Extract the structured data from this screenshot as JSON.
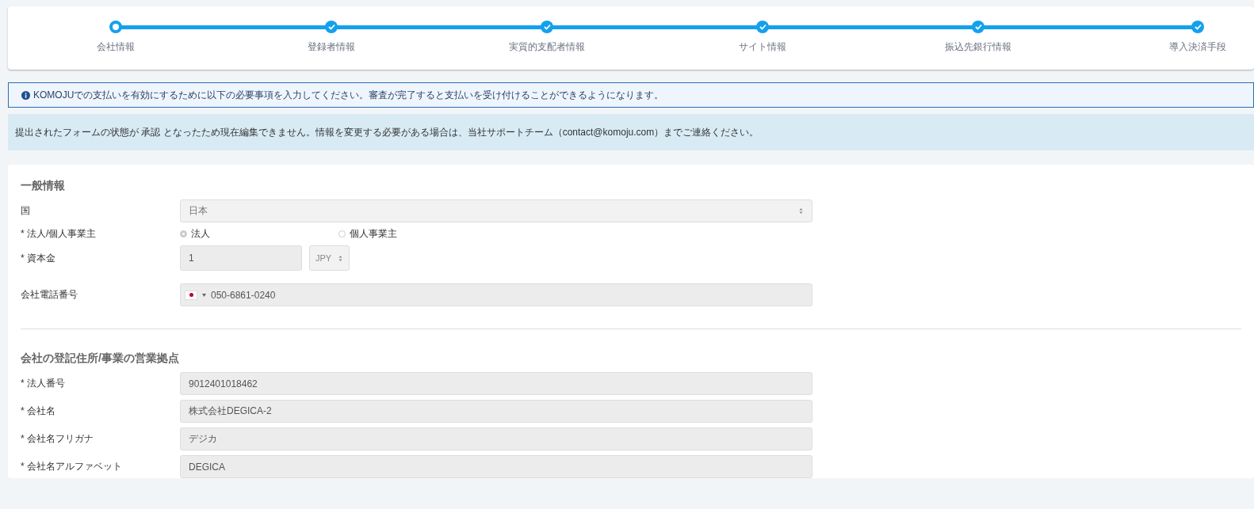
{
  "stepper": {
    "steps": [
      {
        "label": "会社情報",
        "completed": false
      },
      {
        "label": "登録者情報",
        "completed": true
      },
      {
        "label": "実質的支配者情報",
        "completed": true
      },
      {
        "label": "サイト情報",
        "completed": true
      },
      {
        "label": "振込先銀行情報",
        "completed": true
      },
      {
        "label": "導入決済手段",
        "completed": true
      }
    ]
  },
  "info_notice": {
    "text": "KOMOJUでの支払いを有効にするために以下の必要事項を入力してください。審査が完了すると支払いを受け付けることができるようになります。"
  },
  "status_alert": {
    "text": "提出されたフォームの状態が 承認 となったため現在編集できません。情報を変更する必要がある場合は、当社サポートチーム（contact@komoju.com）までご連絡ください。"
  },
  "sections": [
    {
      "title": "一般情報",
      "fields": [
        {
          "kind": "select",
          "label": "国",
          "value": "日本"
        },
        {
          "kind": "radio",
          "label": "* 法人/個人事業主",
          "options": [
            {
              "label": "法人",
              "selected": true
            },
            {
              "label": "個人事業主",
              "selected": false
            }
          ]
        },
        {
          "kind": "amount",
          "label": "* 資本金",
          "value": "1",
          "currency": "JPY"
        },
        {
          "kind": "phone",
          "label": "会社電話番号",
          "value": "050-6861-0240"
        }
      ]
    },
    {
      "title": "会社の登記住所/事業の営業拠点",
      "fields": [
        {
          "kind": "text",
          "label": "* 法人番号",
          "value": "9012401018462"
        },
        {
          "kind": "text",
          "label": "* 会社名",
          "value": "株式会社DEGICA-2"
        },
        {
          "kind": "text",
          "label": "* 会社名フリガナ",
          "value": "デジカ"
        },
        {
          "kind": "text",
          "label": "* 会社名アルファベット",
          "value": "DEGICA"
        }
      ]
    }
  ]
}
